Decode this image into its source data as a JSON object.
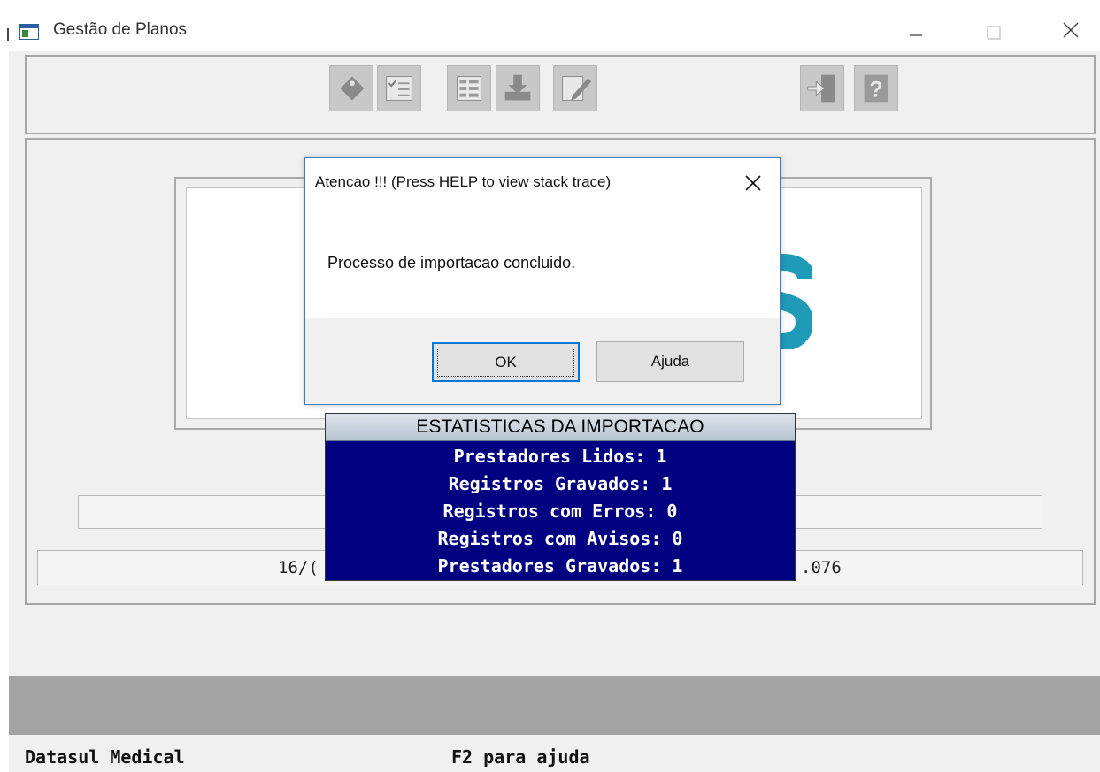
{
  "window": {
    "title": "Gestão de Planos"
  },
  "toolbar": {
    "icons": [
      "tag-icon",
      "checklist-icon",
      "grid-form-icon",
      "import-icon",
      "edit-icon",
      "exit-icon",
      "help-icon"
    ]
  },
  "main": {
    "field2_left": "16/(",
    "field2_right": ".076"
  },
  "stats": {
    "heading": "ESTATISTICAS DA IMPORTACAO",
    "lines": [
      "Prestadores Lidos: 1",
      "Registros Gravados: 1",
      "Registros com Erros: 0",
      "Registros com Avisos: 0",
      "Prestadores Gravados: 1"
    ]
  },
  "dialog": {
    "title": "Atencao !!!  (Press HELP to view stack trace)",
    "message": "Processo de importacao concluido.",
    "ok_label": "OK",
    "help_label": "Ajuda"
  },
  "statusbar": {
    "left": "Datasul Medical",
    "right": "F2 para ajuda"
  },
  "colors": {
    "dialog_border": "#3c7fc1",
    "stats_bg": "#000080",
    "logo_accent": "#1f9bb7"
  }
}
